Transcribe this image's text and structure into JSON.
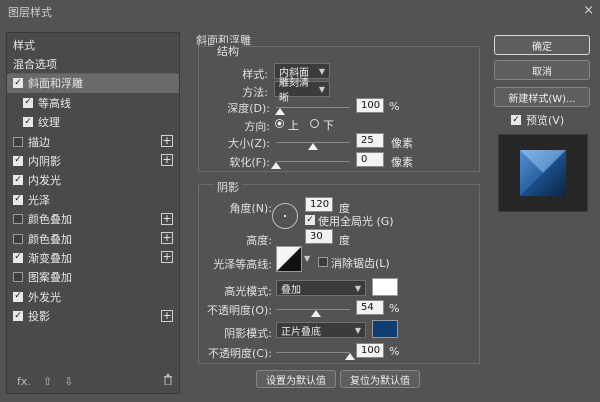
{
  "window": {
    "title": "图层样式",
    "close": "×"
  },
  "left_panel": {
    "items": [
      {
        "label": "样式",
        "checkbox": false,
        "checked": false,
        "plus": false,
        "selected": false,
        "indent": false
      },
      {
        "label": "混合选项",
        "checkbox": false,
        "checked": false,
        "plus": false,
        "selected": false,
        "indent": false
      },
      {
        "label": "斜面和浮雕",
        "checkbox": true,
        "checked": true,
        "plus": false,
        "selected": true,
        "indent": false
      },
      {
        "label": "等高线",
        "checkbox": true,
        "checked": true,
        "plus": false,
        "selected": false,
        "indent": true
      },
      {
        "label": "纹理",
        "checkbox": true,
        "checked": true,
        "plus": false,
        "selected": false,
        "indent": true
      },
      {
        "label": "描边",
        "checkbox": true,
        "checked": false,
        "plus": true,
        "selected": false,
        "indent": false
      },
      {
        "label": "内阴影",
        "checkbox": true,
        "checked": true,
        "plus": true,
        "selected": false,
        "indent": false
      },
      {
        "label": "内发光",
        "checkbox": true,
        "checked": true,
        "plus": false,
        "selected": false,
        "indent": false
      },
      {
        "label": "光泽",
        "checkbox": true,
        "checked": true,
        "plus": false,
        "selected": false,
        "indent": false
      },
      {
        "label": "颜色叠加",
        "checkbox": true,
        "checked": false,
        "plus": true,
        "selected": false,
        "indent": false
      },
      {
        "label": "颜色叠加",
        "checkbox": true,
        "checked": false,
        "plus": true,
        "selected": false,
        "indent": false
      },
      {
        "label": "渐变叠加",
        "checkbox": true,
        "checked": true,
        "plus": true,
        "selected": false,
        "indent": false
      },
      {
        "label": "图案叠加",
        "checkbox": true,
        "checked": false,
        "plus": false,
        "selected": false,
        "indent": false
      },
      {
        "label": "外发光",
        "checkbox": true,
        "checked": true,
        "plus": false,
        "selected": false,
        "indent": false
      },
      {
        "label": "投影",
        "checkbox": true,
        "checked": true,
        "plus": true,
        "selected": false,
        "indent": false
      }
    ],
    "footer": {
      "fx": "fx.",
      "up": "⇧",
      "down": "⇩",
      "trash": "🗑"
    }
  },
  "bevel": {
    "section_title": "斜面和浮雕",
    "structure_title": "结构",
    "style_label": "样式:",
    "style_value": "内斜面",
    "method_label": "方法:",
    "method_value": "雕刻清晰",
    "depth_label": "深度(D):",
    "depth_value": "100",
    "depth_unit": "%",
    "depth_level": 0.05,
    "direction_label": "方向:",
    "direction_up": "上",
    "direction_down": "下",
    "size_label": "大小(Z):",
    "size_value": "25",
    "size_unit": "像素",
    "size_level": 0.5,
    "soften_label": "软化(F):",
    "soften_value": "0",
    "soften_unit": "像素",
    "soften_level": 0.0
  },
  "shading": {
    "section_title": "阴影",
    "angle_label": "角度(N):",
    "angle_value": "120",
    "angle_unit": "度",
    "global_light_label": "使用全局光 (G)",
    "altitude_label": "高度:",
    "altitude_value": "30",
    "altitude_unit": "度",
    "gloss_label": "光泽等高线:",
    "antialias_label": "消除锯齿(L)",
    "highlight_mode_label": "高光模式:",
    "highlight_mode_value": "叠加",
    "highlight_color": "#ffffff",
    "opacity1_label": "不透明度(O):",
    "opacity1_value": "54",
    "opacity1_unit": "%",
    "opacity1_level": 0.54,
    "shadow_mode_label": "阴影模式:",
    "shadow_mode_value": "正片叠底",
    "shadow_color": "#0f3d73",
    "opacity2_label": "不透明度(C):",
    "opacity2_value": "100",
    "opacity2_unit": "%",
    "opacity2_level": 1.0
  },
  "bottom_buttons": {
    "set_default": "设置为默认值",
    "reset_default": "复位为默认值"
  },
  "right": {
    "ok": "确定",
    "cancel": "取消",
    "new_style": "新建样式(W)...",
    "preview": "预览(V)"
  }
}
